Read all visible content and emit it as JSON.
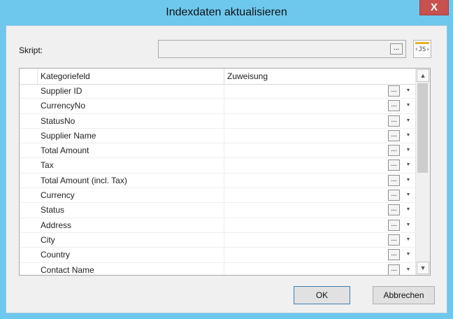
{
  "window": {
    "title": "Indexdaten aktualisieren",
    "close_glyph": "X"
  },
  "script": {
    "label": "Skript:",
    "value": "",
    "ellipsis": "...",
    "js_label": "‹JS›"
  },
  "grid": {
    "columns": [
      "Kategoriefeld",
      "Zuweisung"
    ],
    "cell_button": "...",
    "dropdown_glyph": "▼",
    "rows": [
      "Supplier ID",
      "CurrencyNo",
      "StatusNo",
      "Supplier Name",
      "Total Amount",
      "Tax",
      "Total Amount (incl. Tax)",
      "Currency",
      "Status",
      "Address",
      "City",
      "Country",
      "Contact Name"
    ]
  },
  "scrollbar": {
    "up": "▲",
    "down": "▼"
  },
  "buttons": {
    "ok": "OK",
    "cancel": "Abbrechen"
  }
}
